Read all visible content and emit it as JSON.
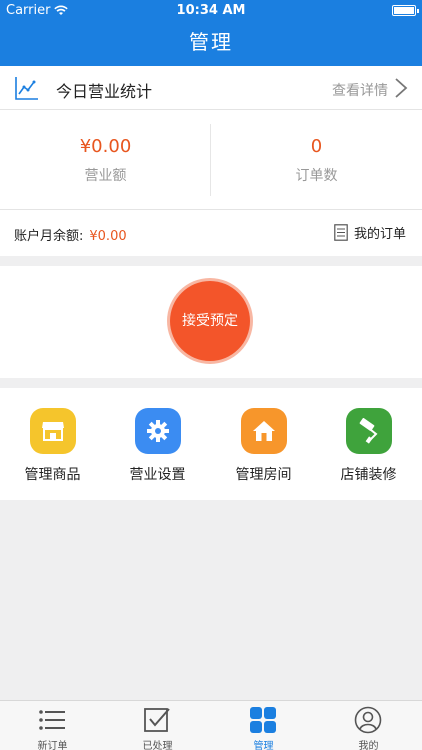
{
  "status_bar": {
    "carrier": "Carrier",
    "time": "10:34 AM"
  },
  "nav": {
    "title": "管理"
  },
  "stats": {
    "label": "今日营业统计",
    "detail_link": "查看详情"
  },
  "metrics": [
    {
      "value": "¥0.00",
      "label": "营业额"
    },
    {
      "value": "0",
      "label": "订单数"
    }
  ],
  "balance": {
    "label": "账户月余额:",
    "value": "¥0.00",
    "orders_link": "我的订单"
  },
  "accept_button": "接受预定",
  "grid": [
    {
      "label": "管理商品",
      "icon": "store-icon",
      "color": "#f5c52c"
    },
    {
      "label": "营业设置",
      "icon": "gear-icon",
      "color": "#3b8cf2"
    },
    {
      "label": "管理房间",
      "icon": "house-icon",
      "color": "#f7962b"
    },
    {
      "label": "店铺装修",
      "icon": "paint-roller-icon",
      "color": "#3fa33c"
    }
  ],
  "tabs": [
    {
      "label": "新订单",
      "icon": "list-icon"
    },
    {
      "label": "已处理",
      "icon": "checkbox-icon"
    },
    {
      "label": "管理",
      "icon": "grid-icon",
      "active": true
    },
    {
      "label": "我的",
      "icon": "user-icon"
    }
  ],
  "colors": {
    "brand": "#1b7fe0",
    "accent": "#e8561f",
    "accept": "#f3552a"
  }
}
